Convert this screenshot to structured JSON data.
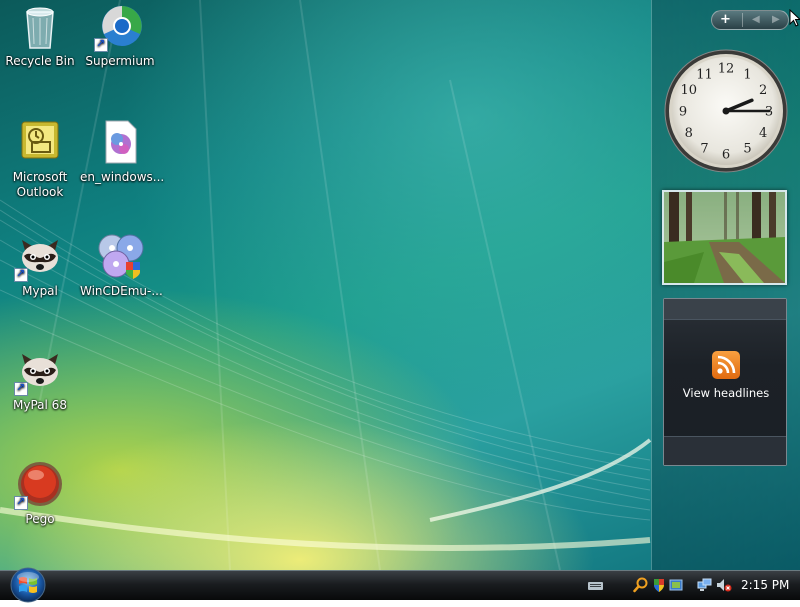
{
  "desktop_icons": [
    {
      "label": "Recycle Bin"
    },
    {
      "label": "Supermium"
    },
    {
      "label": "Microsoft Outlook"
    },
    {
      "label": "en_windows..."
    },
    {
      "label": "Mypal"
    },
    {
      "label": "WinCDEmu-..."
    },
    {
      "label": "MyPal 68"
    },
    {
      "label": "Pego"
    }
  ],
  "sidebar": {
    "add_label": "+",
    "prev_label": "◀",
    "next_label": "▶",
    "clock": {
      "hour": 2,
      "minute": 15
    },
    "feed": {
      "label": "View headlines"
    }
  },
  "taskbar": {
    "time": "2:15 PM",
    "tray_icons": [
      "keyboard-icon",
      "search-icon",
      "security-icon",
      "network-icon",
      "volume-muted-icon"
    ]
  },
  "colors": {
    "wallpaper_teal": "#0f8080",
    "taskbar": "#1a1d20",
    "rss_orange": "#f08a2a"
  }
}
